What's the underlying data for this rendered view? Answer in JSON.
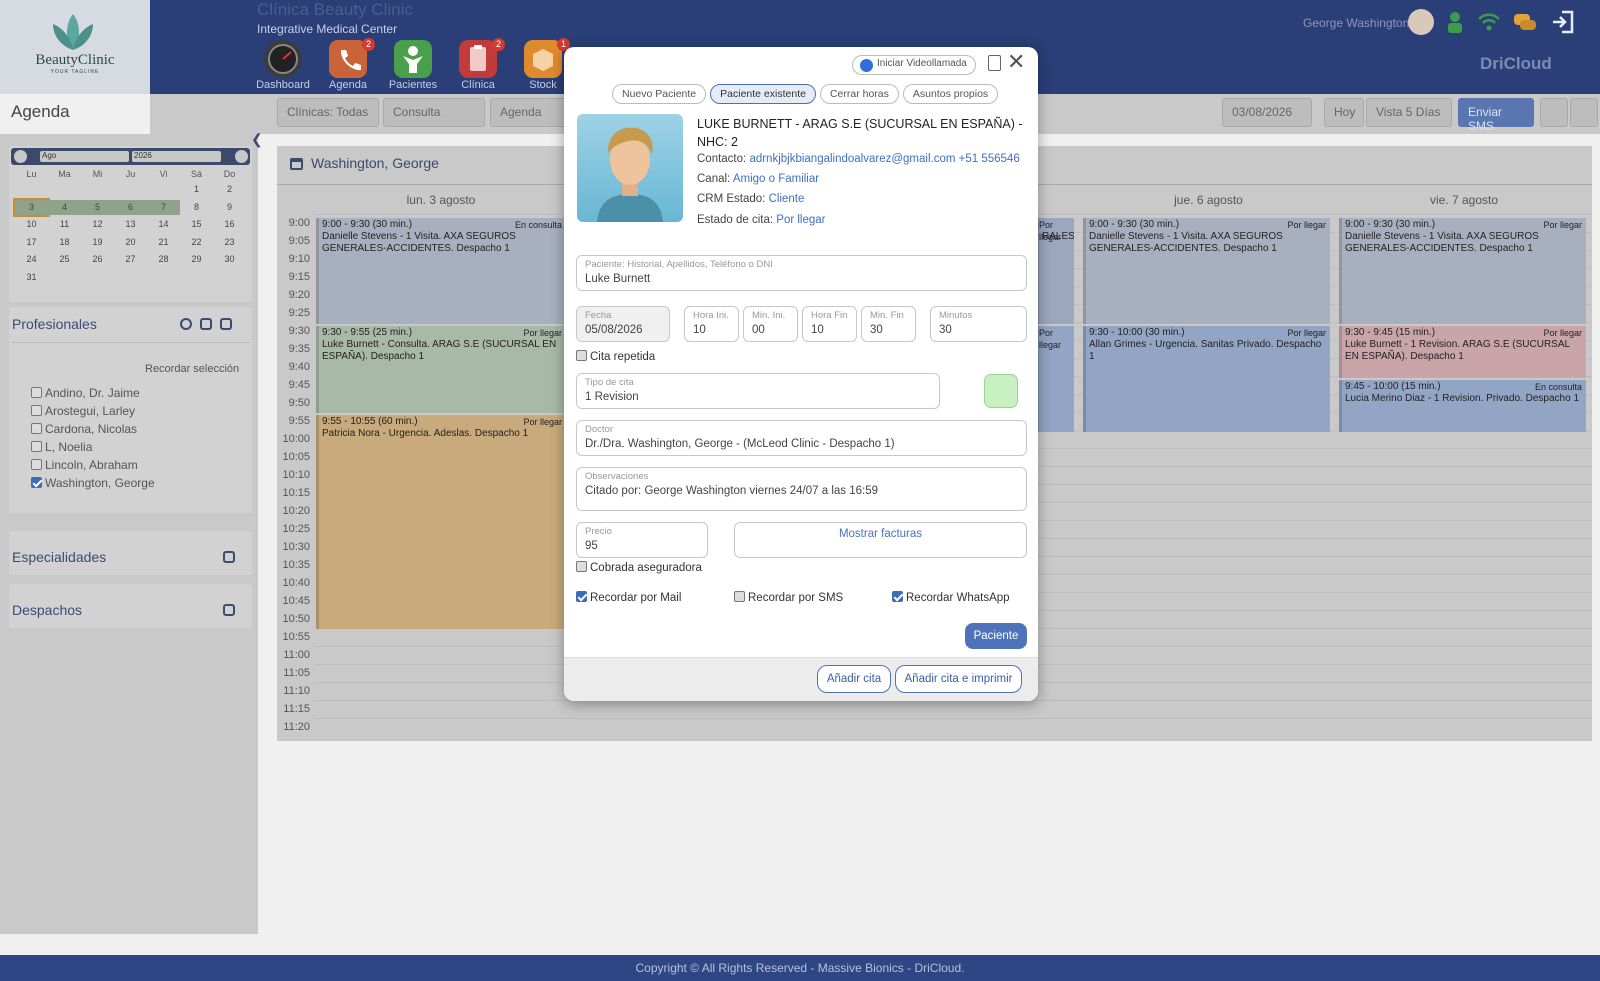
{
  "header": {
    "logo_text": "BeautyClinic",
    "logo_tagline": "YOUR TAGLINE",
    "clinic_name": "Clínica Beauty Clinic",
    "clinic_subtitle": "Integrative Medical Center",
    "user_name": "George Washington",
    "brand": "DriCloud",
    "modules": [
      {
        "label": "Dashboard",
        "icon": "dashboard-icon",
        "badge": "",
        "color": "#333333"
      },
      {
        "label": "Agenda",
        "icon": "phone-icon",
        "badge": "2",
        "color": "#c9643a"
      },
      {
        "label": "Pacientes",
        "icon": "patient-icon",
        "badge": "",
        "color": "#4aa04a"
      },
      {
        "label": "Clínica",
        "icon": "clipboard-icon",
        "badge": "2",
        "color": "#c23b3b"
      },
      {
        "label": "Stock",
        "icon": "box-icon",
        "badge": "1",
        "color": "#e08a2e"
      }
    ]
  },
  "toolbar": {
    "page_title": "Agenda",
    "clinic_filter": "Clínicas: Todas",
    "type_filter": "Consulta",
    "view_filter": "Agenda",
    "date": "03/08/2026",
    "today_label": "Hoy",
    "view_label": "Vista 5 Días",
    "sms_label": "Enviar SMS"
  },
  "mini_calendar": {
    "month": "Ago",
    "year": "2026",
    "weekdays": [
      "Lu",
      "Ma",
      "Mi",
      "Ju",
      "Vi",
      "Sá",
      "Do"
    ],
    "weeks": [
      [
        "",
        "",
        "",
        "",
        "",
        "1",
        "2"
      ],
      [
        "3",
        "4",
        "5",
        "6",
        "7",
        "8",
        "9"
      ],
      [
        "10",
        "11",
        "12",
        "13",
        "14",
        "15",
        "16"
      ],
      [
        "17",
        "18",
        "19",
        "20",
        "21",
        "22",
        "23"
      ],
      [
        "24",
        "25",
        "26",
        "27",
        "28",
        "29",
        "30"
      ],
      [
        "31",
        "",
        "",
        "",
        "",
        "",
        ""
      ]
    ]
  },
  "professionals": {
    "title": "Profesionales",
    "remember": "Recordar selección",
    "items": [
      {
        "name": "Andino, Dr. Jaime",
        "checked": false
      },
      {
        "name": "Arostegui, Larley",
        "checked": false
      },
      {
        "name": "Cardona, Nicolas",
        "checked": false
      },
      {
        "name": "L, Noelia",
        "checked": false
      },
      {
        "name": "Lincoln, Abraham",
        "checked": false
      },
      {
        "name": "Washington, George",
        "checked": true
      }
    ]
  },
  "specialties": {
    "title": "Especialidades"
  },
  "offices": {
    "title": "Despachos"
  },
  "calendar": {
    "doctor": "Washington, George",
    "columns": [
      "lun. 3 agosto",
      "jue. 6 agosto",
      "vie. 7 agosto"
    ],
    "times": [
      "9:00",
      "9:05",
      "9:10",
      "9:15",
      "9:20",
      "9:25",
      "9:30",
      "9:35",
      "9:40",
      "9:45",
      "9:50",
      "9:55",
      "10:00",
      "10:05",
      "10:10",
      "10:15",
      "10:20",
      "10:25",
      "10:30",
      "10:35",
      "10:40",
      "10:45",
      "10:50",
      "10:55",
      "11:00",
      "11:05",
      "11:10",
      "11:15",
      "11:20"
    ],
    "events": {
      "mon1": {
        "time": "9:00 - 9:30 (30 min.)",
        "status": "En consulta",
        "text": "Danielle Stevens - 1 Visita. AXA SEGUROS GENERALES-ACCIDENTES. Despacho 1"
      },
      "mon2": {
        "time": "9:30 - 9:55 (25 min.)",
        "status": "Por llegar",
        "text": "Luke Burnett - Consulta. ARAG S.E (SUCURSAL EN ESPAÑA). Despacho 1"
      },
      "mon3": {
        "time": "9:55 - 10:55 (60 min.)",
        "status": "Por llegar",
        "text": "Patricia Nora - Urgencia. Adeslas. Despacho 1"
      },
      "wed1": {
        "status": "Por llegar",
        "text": "RALES-"
      },
      "wed2": {
        "status": "Por llegar"
      },
      "thu1": {
        "time": "9:00 - 9:30 (30 min.)",
        "status": "Por llegar",
        "text": "Danielle Stevens - 1 Visita. AXA SEGUROS GENERALES-ACCIDENTES. Despacho 1"
      },
      "thu2": {
        "time": "9:30 - 10:00 (30 min.)",
        "status": "Por llegar",
        "text": "Allan Grimes - Urgencia. Sanitas Privado. Despacho 1"
      },
      "fri1": {
        "time": "9:00 - 9:30 (30 min.)",
        "status": "Por llegar",
        "text": "Danielle Stevens - 1 Visita. AXA SEGUROS GENERALES-ACCIDENTES. Despacho 1"
      },
      "fri2": {
        "time": "9:30 - 9:45 (15 min.)",
        "status": "Por llegar",
        "text": "Luke Burnett - 1 Revision. ARAG S.E (SUCURSAL EN ESPAÑA). Despacho 1"
      },
      "fri3": {
        "time": "9:45 - 10:00 (15 min.)",
        "status": "En consulta",
        "text": "Lucia Merino Diaz - 1 Revision. Privado. Despacho 1"
      }
    }
  },
  "modal": {
    "video_call": "Iniciar Videollamada",
    "tabs": [
      "Nuevo Paciente",
      "Paciente existente",
      "Cerrar horas",
      "Asuntos propios"
    ],
    "patient_title": "LUKE BURNETT - ARAG S.E (SUCURSAL EN ESPAÑA) - NHC: 2",
    "contact_label": "Contacto:",
    "contact_value": "adrnkjbjkbiangalindoalvarez@gmail.com +51 556546",
    "channel_label": "Canal:",
    "channel_value": "Amigo o Familiar",
    "crm_label": "CRM Estado:",
    "crm_value": "Cliente",
    "status_label": "Estado de cita:",
    "status_value": "Por llegar",
    "search_label": "Paciente: Historial, Apellidos, Teléfono o DNI",
    "search_value": "Luke Burnett",
    "date_label": "Fecha",
    "date_value": "05/08/2026",
    "hour_ini_label": "Hora Ini.",
    "hour_ini_value": "10",
    "min_ini_label": "Min. Ini.",
    "min_ini_value": "00",
    "hour_end_label": "Hora Fin",
    "hour_end_value": "10",
    "min_end_label": "Min. Fin",
    "min_end_value": "30",
    "minutes_label": "Minutos",
    "minutes_value": "30",
    "repeat_label": "Cita repetida",
    "type_label": "Tipo de cita",
    "type_value": "1 Revision",
    "type_color": "#c8f0c0",
    "doctor_label": "Doctor",
    "doctor_value": "Dr./Dra. Washington, George - (McLeod Clinic - Despacho 1)",
    "obs_label": "Observaciones",
    "obs_value": "Citado por: George Washington viernes 24/07 a las 16:59",
    "price_label": "Precio",
    "price_value": "95",
    "invoices_label": "Mostrar facturas",
    "insurer_label": "Cobrada aseguradora",
    "remind_mail": "Recordar por Mail",
    "remind_sms": "Recordar por SMS",
    "remind_whatsapp": "Recordar WhatsApp",
    "patient_btn": "Paciente",
    "add_btn": "Añadir cita",
    "add_print_btn": "Añadir cita e imprimir"
  },
  "footer": {
    "text": "Copyright © All Rights Reserved - Massive Bionics - DriCloud."
  }
}
